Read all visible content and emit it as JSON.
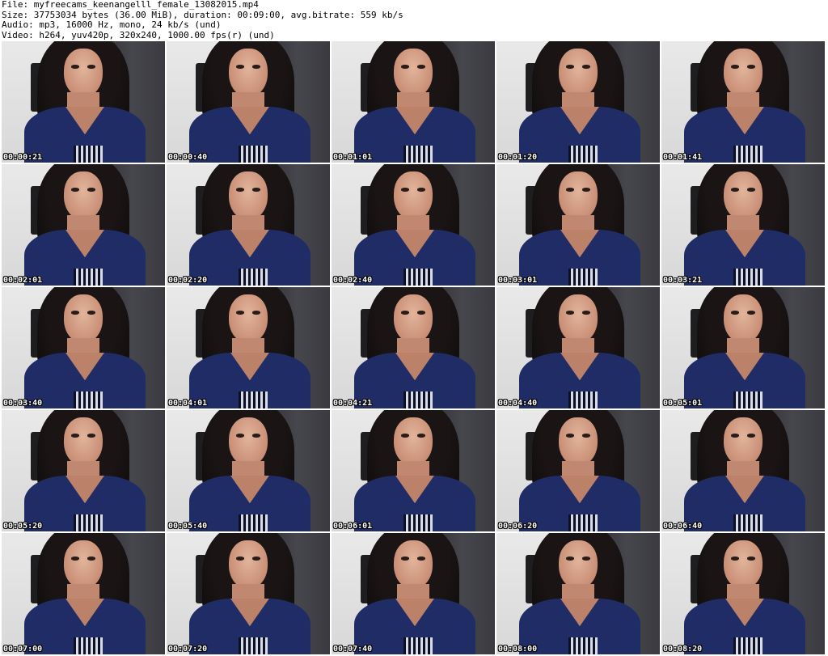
{
  "meta": {
    "file_line": "File: myfreecams_keenangelll_female_13082015.mp4",
    "size_line": "Size: 37753034 bytes (36.00 MiB), duration: 00:09:00, avg.bitrate: 559 kb/s",
    "audio_line": "Audio: mp3, 16000 Hz, mono, 24 kb/s (und)",
    "video_line": "Video: h264, yuv420p, 320x240, 1000.00 fps(r) (und)"
  },
  "thumbnails": [
    {
      "timestamp": "00:00:21"
    },
    {
      "timestamp": "00:00:40"
    },
    {
      "timestamp": "00:01:01"
    },
    {
      "timestamp": "00:01:20"
    },
    {
      "timestamp": "00:01:41"
    },
    {
      "timestamp": "00:02:01"
    },
    {
      "timestamp": "00:02:20"
    },
    {
      "timestamp": "00:02:40"
    },
    {
      "timestamp": "00:03:01"
    },
    {
      "timestamp": "00:03:21"
    },
    {
      "timestamp": "00:03:40"
    },
    {
      "timestamp": "00:04:01"
    },
    {
      "timestamp": "00:04:21"
    },
    {
      "timestamp": "00:04:40"
    },
    {
      "timestamp": "00:05:01"
    },
    {
      "timestamp": "00:05:20"
    },
    {
      "timestamp": "00:05:40"
    },
    {
      "timestamp": "00:06:01"
    },
    {
      "timestamp": "00:06:20"
    },
    {
      "timestamp": "00:06:40"
    },
    {
      "timestamp": "00:07:00"
    },
    {
      "timestamp": "00:07:20"
    },
    {
      "timestamp": "00:07:40"
    },
    {
      "timestamp": "00:08:00"
    },
    {
      "timestamp": "00:08:20"
    }
  ]
}
